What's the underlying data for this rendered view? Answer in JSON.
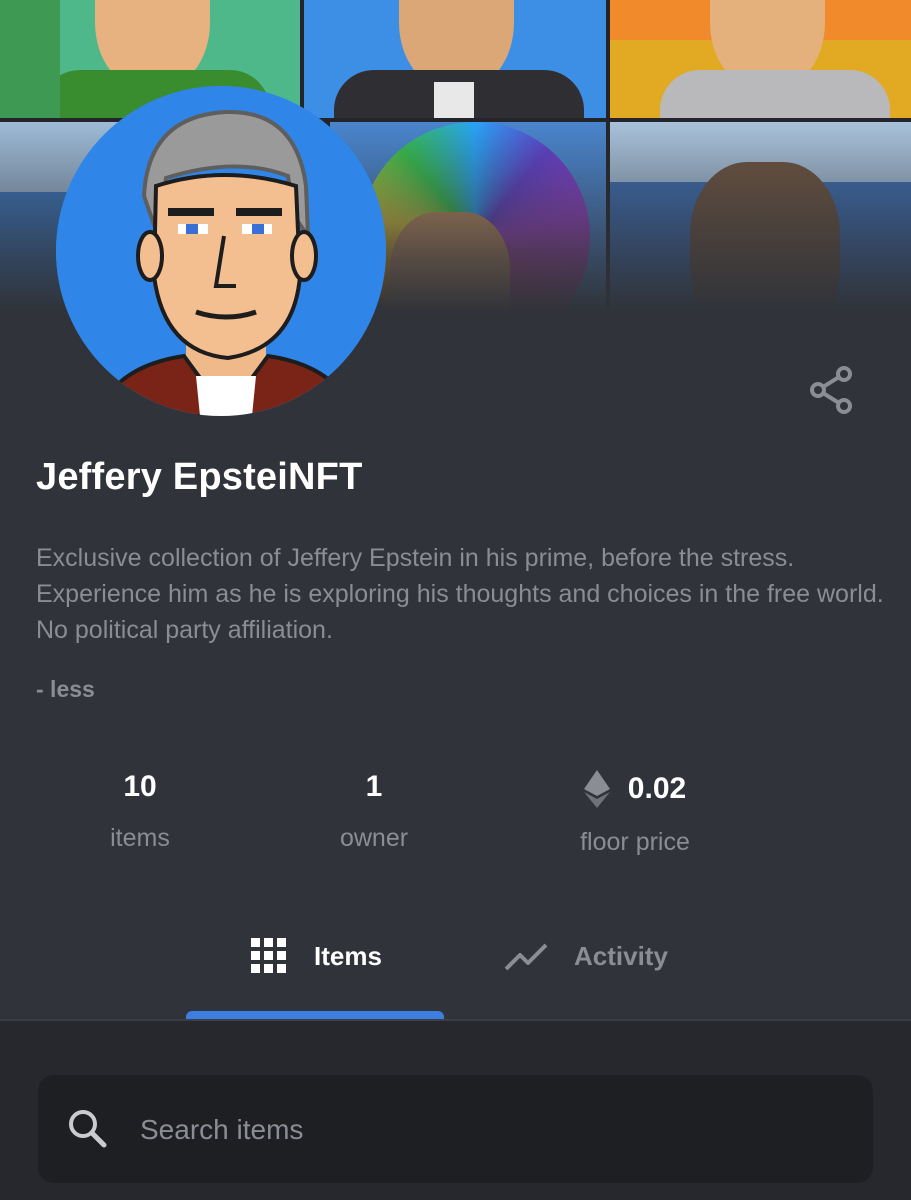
{
  "collection": {
    "name": "Jeffery EpsteiNFT",
    "description": "Exclusive collection of Jeffery Epstein in his prime, before the stress. Experience him as he is exploring his thoughts and choices in the free world. No political party affiliation.",
    "less_toggle": "- less"
  },
  "stats": [
    {
      "value": "10",
      "label": "items"
    },
    {
      "value": "1",
      "label": "owner"
    },
    {
      "value": "0.02",
      "label": "floor price",
      "currency_icon": "ethereum-icon"
    }
  ],
  "tabs": [
    {
      "label": "Items",
      "icon": "grid-icon",
      "active": true
    },
    {
      "label": "Activity",
      "icon": "trend-line-icon",
      "active": false
    }
  ],
  "search": {
    "placeholder": "Search items",
    "icon": "search-icon",
    "value": ""
  },
  "icons": {
    "share": "share-icon"
  },
  "colors": {
    "background": "#303339",
    "accent": "#3d7fe0",
    "text_primary": "#ffffff",
    "text_secondary": "#8a8d93",
    "search_bg": "#1d1f23"
  }
}
